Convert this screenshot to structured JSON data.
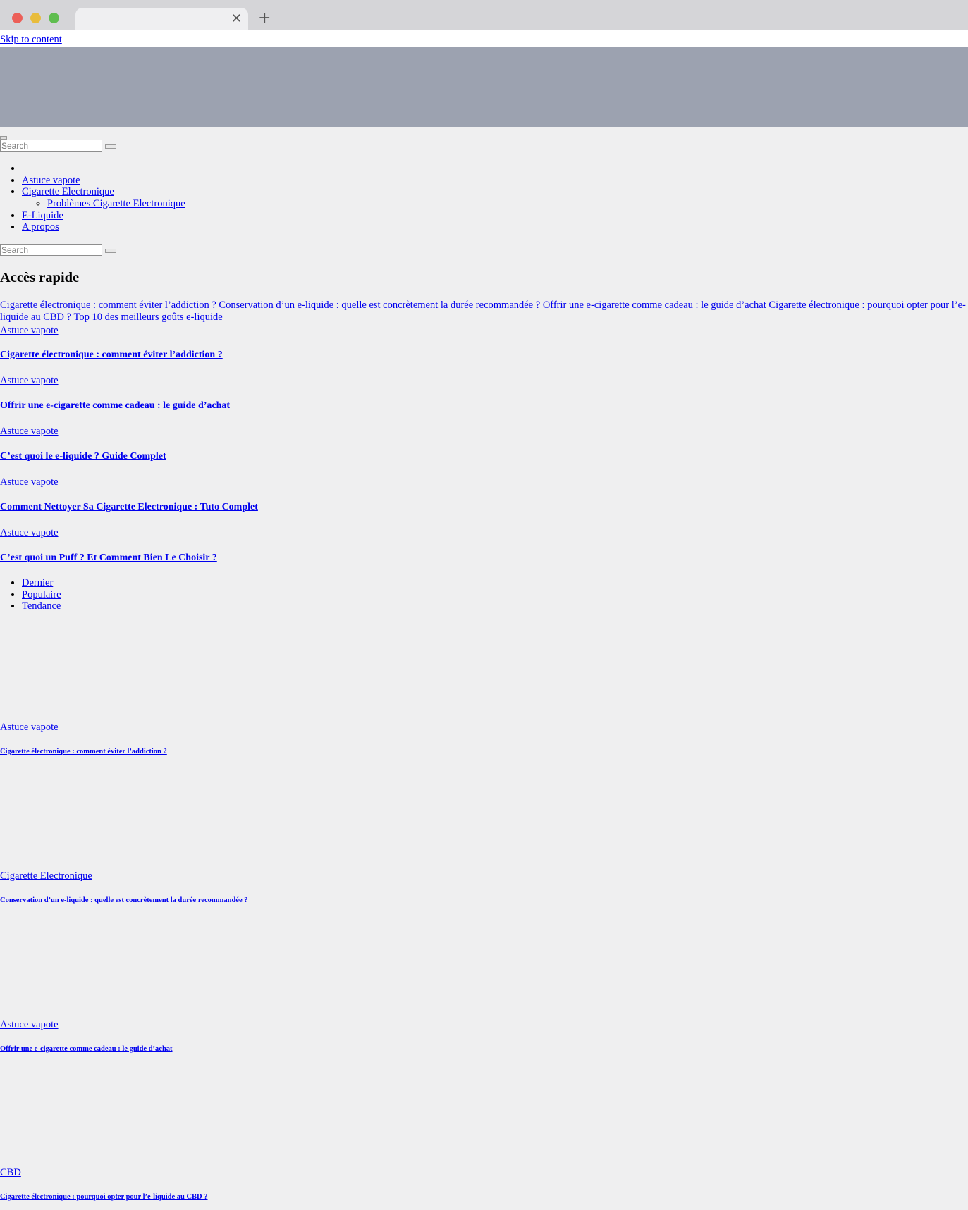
{
  "skip_link": "Skip to content",
  "search": {
    "placeholder": "Search"
  },
  "nav": {
    "items": [
      {
        "label": "Astuce vapote"
      },
      {
        "label": "Cigarette Electronique",
        "children": [
          {
            "label": "Problèmes Cigarette Electronique"
          }
        ]
      },
      {
        "label": "E-Liquide"
      },
      {
        "label": "A propos"
      }
    ]
  },
  "quick_access": {
    "heading": "Accès rapide",
    "links": [
      "Cigarette électronique : comment éviter l’addiction ?",
      "Conservation d’un e-liquide : quelle est concrètement la durée recommandée ?",
      "Offrir une e-cigarette comme cadeau : le guide d’achat",
      "Cigarette électronique : pourquoi opter pour l’e-liquide au CBD ?",
      "Top 10 des meilleurs goûts e-liquide"
    ]
  },
  "posts": [
    {
      "category": "Astuce vapote",
      "title": "Cigarette électronique : comment éviter l’addiction ?"
    },
    {
      "category": "Astuce vapote",
      "title": "Offrir une e-cigarette comme cadeau : le guide d’achat"
    },
    {
      "category": "Astuce vapote",
      "title": "C’est quoi le e-liquide ? Guide Complet"
    },
    {
      "category": "Astuce vapote",
      "title": "Comment Nettoyer Sa Cigarette Electronique : Tuto Complet"
    },
    {
      "category": "Astuce vapote",
      "title": "C’est quoi un Puff ? Et Comment Bien Le Choisir ?"
    }
  ],
  "tabs": [
    "Dernier",
    "Populaire",
    "Tendance"
  ],
  "latest_posts": [
    {
      "category": "Astuce vapote",
      "title": "Cigarette électronique : comment éviter l’addiction ?"
    },
    {
      "category": "Cigarette Electronique",
      "title": "Conservation d’un e-liquide : quelle est concrètement la durée recommandée ?"
    },
    {
      "category": "Astuce vapote",
      "title": "Offrir une e-cigarette comme cadeau : le guide d’achat"
    },
    {
      "category": "CBD",
      "title": "Cigarette électronique : pourquoi opter pour l’e-liquide au CBD ?"
    }
  ]
}
